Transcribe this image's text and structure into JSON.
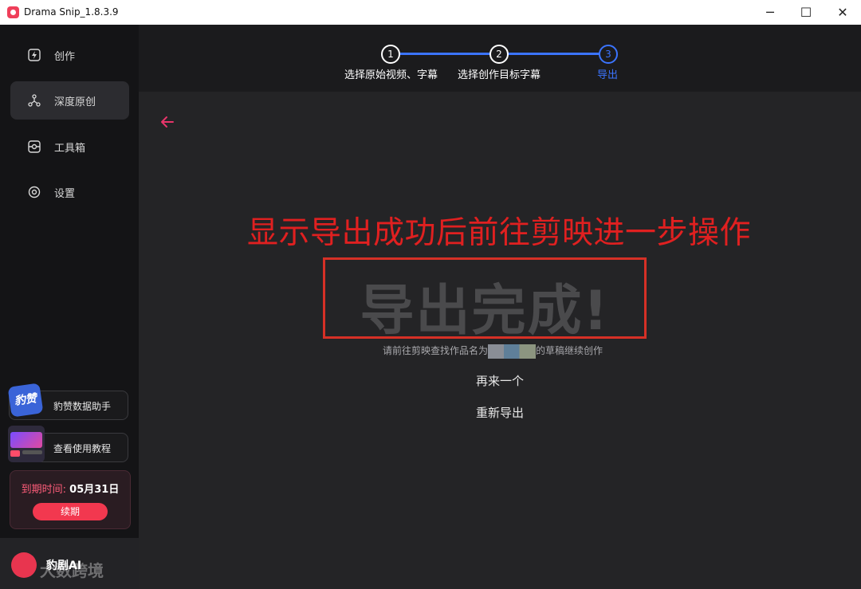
{
  "window": {
    "title": "Drama Snip_1.8.3.9",
    "controls": {
      "minimize": "─",
      "maximize": "☐",
      "close": "✕"
    }
  },
  "sidebar": {
    "items": [
      {
        "label": "创作",
        "icon": "lightning-icon",
        "active": false
      },
      {
        "label": "深度原创",
        "icon": "molecule-icon",
        "active": true
      },
      {
        "label": "工具箱",
        "icon": "toolbox-icon",
        "active": false
      },
      {
        "label": "设置",
        "icon": "settings-icon",
        "active": false
      }
    ],
    "promos": [
      {
        "label": "豹赞数据助手",
        "icon": "baozan-logo",
        "icon_text": "豹赞"
      },
      {
        "label": "查看使用教程",
        "icon": "tutorial-thumbnail"
      }
    ],
    "expire": {
      "prefix": "到期时间: ",
      "date": "05月31日",
      "renew_label": "续期"
    },
    "brand": {
      "name": "豹剧AI"
    }
  },
  "steps": [
    {
      "number": "1",
      "label": "选择原始视频、字幕",
      "state": "done"
    },
    {
      "number": "2",
      "label": "选择创作目标字幕",
      "state": "done"
    },
    {
      "number": "3",
      "label": "导出",
      "state": "current"
    }
  ],
  "main": {
    "annotation": "显示导出成功后前往剪映进一步操作",
    "done_title": "导出完成!",
    "hint_before": "请前往剪映查找作品名为",
    "hint_after": "的草稿继续创作",
    "again_label": "再来一个",
    "reexport_label": "重新导出"
  },
  "watermark": "大数跨境",
  "colors": {
    "accent_blue": "#3b74ff",
    "accent_red": "#f2384f",
    "annotation_red": "#e02020",
    "back_arrow": "#e8356a"
  }
}
